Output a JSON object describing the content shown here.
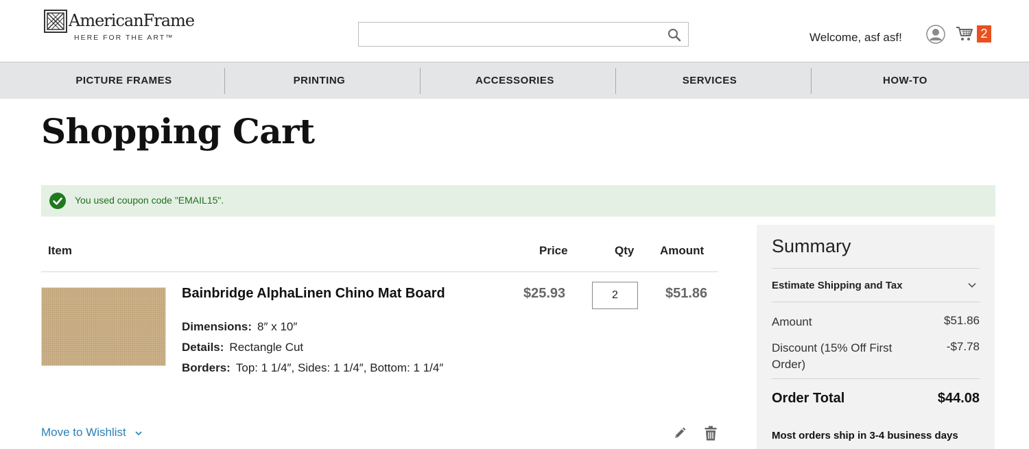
{
  "header": {
    "logo": {
      "name": "AmericanFrame",
      "tagline": "HERE FOR THE ART™"
    },
    "search": {
      "value": "",
      "placeholder": ""
    },
    "search_icon": "search-icon",
    "welcome": "Welcome, asf asf!",
    "account_icon": "user-circle-icon",
    "cart_icon": "shopping-cart-icon",
    "cart_count": "2",
    "cart_badge_color": "#e8511f"
  },
  "nav": {
    "items": [
      {
        "label": "PICTURE FRAMES"
      },
      {
        "label": "PRINTING"
      },
      {
        "label": "ACCESSORIES"
      },
      {
        "label": "SERVICES"
      },
      {
        "label": "HOW-TO"
      }
    ]
  },
  "page": {
    "title": "Shopping Cart"
  },
  "coupon": {
    "message": "You used coupon code \"EMAIL15\".",
    "icon": "check-circle-icon",
    "icon_color": "#1f7a1f",
    "background": "#e5f0e5"
  },
  "cart": {
    "columns": {
      "item": "Item",
      "price": "Price",
      "qty": "Qty",
      "amount": "Amount"
    },
    "items": [
      {
        "name": "Bainbridge AlphaLinen Chino Mat Board",
        "dimensions_label": "Dimensions:",
        "dimensions": "8″ x 10″",
        "details_label": "Details:",
        "details": "Rectangle Cut",
        "borders_label": "Borders:",
        "borders": "Top: 1 1/4″, Sides: 1 1/4″, Bottom: 1 1/4″",
        "price": "$25.93",
        "qty": "2",
        "amount": "$51.86",
        "wishlist_label": "Move to Wishlist",
        "edit_icon": "pencil-icon",
        "delete_icon": "trash-icon"
      }
    ]
  },
  "summary": {
    "title": "Summary",
    "shipping_label": "Estimate Shipping and Tax",
    "amount_label": "Amount",
    "amount_value": "$51.86",
    "discount_label": "Discount (15% Off First Order)",
    "discount_value": "-$7.78",
    "total_label": "Order Total",
    "total_value": "$44.08",
    "shipping_note": "Most orders ship in 3-4 business days"
  },
  "colors": {
    "link": "#2a7fb8",
    "nav_bg": "#e4e5e6",
    "summary_bg": "#f2f2f2"
  }
}
